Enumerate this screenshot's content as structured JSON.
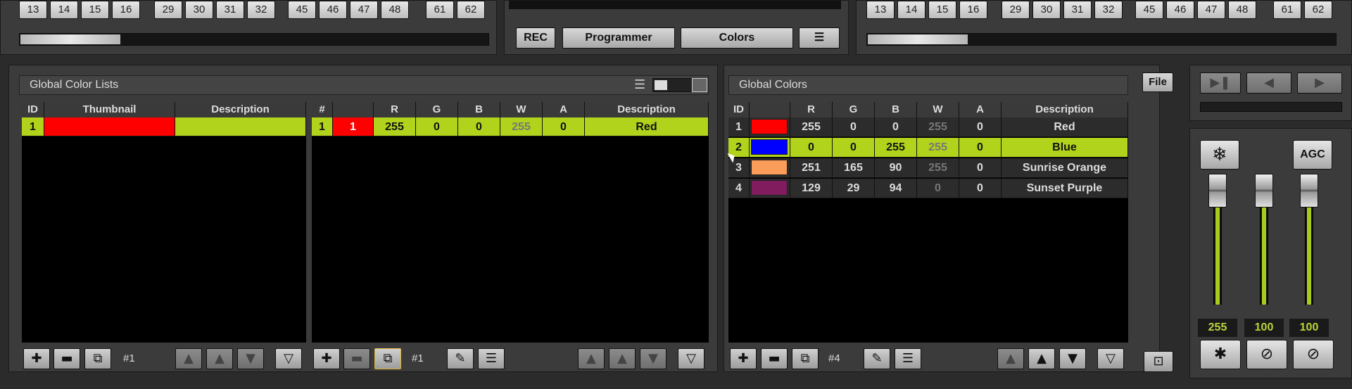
{
  "top": {
    "left_keys": [
      "13",
      "14",
      "15",
      "16",
      "29",
      "30",
      "31",
      "32",
      "45",
      "46",
      "47",
      "48",
      "61",
      "62"
    ],
    "right_keys": [
      "13",
      "14",
      "15",
      "16",
      "29",
      "30",
      "31",
      "32",
      "45",
      "46",
      "47",
      "48",
      "61",
      "62"
    ],
    "rec_label": "REC",
    "programmer_label": "Programmer",
    "colors_label": "Colors"
  },
  "color_lists": {
    "title": "Global Color Lists",
    "list_headers": [
      "ID",
      "Thumbnail",
      "Description"
    ],
    "list_rows": [
      {
        "id": "1",
        "thumb_color": "#ff0000",
        "description": ""
      }
    ],
    "entry_headers": [
      "#",
      "",
      "R",
      "G",
      "B",
      "W",
      "A",
      "Description"
    ],
    "entry_rows": [
      {
        "num": "1",
        "swatch_label": "1",
        "swatch_color": "#ff0000",
        "r": "255",
        "g": "0",
        "b": "0",
        "w": "255",
        "a": "0",
        "description": "Red"
      }
    ],
    "list_counter": "#1",
    "entry_counter": "#1"
  },
  "global_colors": {
    "title": "Global Colors",
    "file_label": "File",
    "headers": [
      "ID",
      "",
      "R",
      "G",
      "B",
      "W",
      "A",
      "Description"
    ],
    "rows": [
      {
        "id": "1",
        "swatch": "#ff0000",
        "r": "255",
        "g": "0",
        "b": "0",
        "w": "255",
        "a": "0",
        "description": "Red"
      },
      {
        "id": "2",
        "swatch": "#0000ff",
        "r": "0",
        "g": "0",
        "b": "255",
        "w": "255",
        "a": "0",
        "description": "Blue"
      },
      {
        "id": "3",
        "swatch": "#fb9d5a",
        "r": "251",
        "g": "165",
        "b": "90",
        "w": "255",
        "a": "0",
        "description": "Sunrise Orange"
      },
      {
        "id": "4",
        "swatch": "#811d5e",
        "r": "129",
        "g": "29",
        "b": "94",
        "w": "0",
        "a": "0",
        "description": "Sunset Purple"
      }
    ],
    "selected_row": 1,
    "counter": "#4"
  },
  "master": {
    "agc_label": "AGC",
    "faders": [
      {
        "value": "255",
        "level": 1.0
      },
      {
        "value": "100",
        "level": 1.0
      },
      {
        "value": "100",
        "level": 1.0
      }
    ]
  },
  "colors": {
    "accent": "#b1d31c",
    "panel": "#3b3b3b",
    "table_bg": "#000000"
  }
}
